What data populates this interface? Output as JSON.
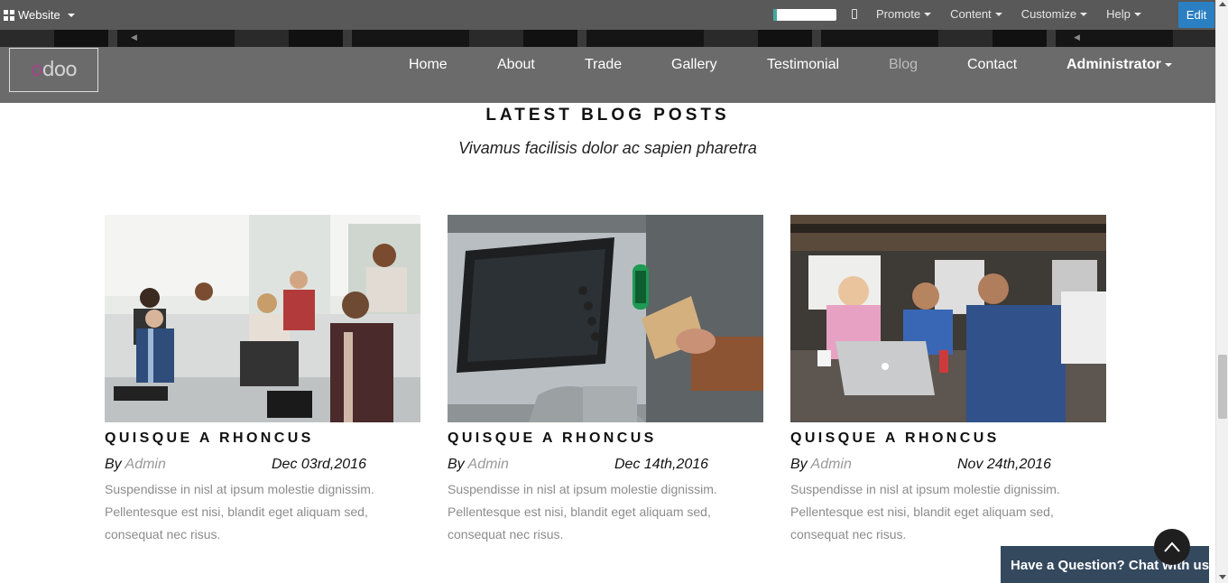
{
  "adminbar": {
    "website_label": "Website",
    "progress_fraction": 0.05,
    "menus": [
      "Promote",
      "Content",
      "Customize",
      "Help"
    ],
    "edit_label": "Edit"
  },
  "navbar": {
    "logo_text": "odoo",
    "items": [
      "Home",
      "About",
      "Trade",
      "Gallery",
      "Testimonial",
      "Blog",
      "Contact",
      "Administrator"
    ],
    "active_item": "Blog"
  },
  "section": {
    "title": "LATEST BLOG POSTS",
    "subtitle": "Vivamus facilisis dolor ac sapien pharetra"
  },
  "posts": [
    {
      "title": "QUISQUE A RHONCUS",
      "by_label": "By",
      "author": "Admin",
      "date": "Dec 03rd,2016",
      "excerpt": "Suspendisse in nisl at ipsum molestie dignissim. Pellentesque est nisi, blandit eget aliquam sed, consequat nec risus.",
      "image_icon": "office-meeting-image"
    },
    {
      "title": "QUISQUE A RHONCUS",
      "by_label": "By",
      "author": "Admin",
      "date": "Dec 14th,2016",
      "excerpt": "Suspendisse in nisl at ipsum molestie dignissim. Pellentesque est nisi, blandit eget aliquam sed, consequat nec risus.",
      "image_icon": "atm-cash-image"
    },
    {
      "title": "QUISQUE A RHONCUS",
      "by_label": "By",
      "author": "Admin",
      "date": "Nov 24th,2016",
      "excerpt": "Suspendisse in nisl at ipsum molestie dignissim. Pellentesque est nisi, blandit eget aliquam sed, consequat nec risus.",
      "image_icon": "team-laptop-image"
    }
  ],
  "chat": {
    "label": "Have a Question? Chat with us."
  },
  "colors": {
    "adminbar_bg": "#595959",
    "navbar_bg": "#6b6b6b",
    "edit_button": "#2b7fc3",
    "chat_bg": "#34495e",
    "author_link": "#999999"
  }
}
